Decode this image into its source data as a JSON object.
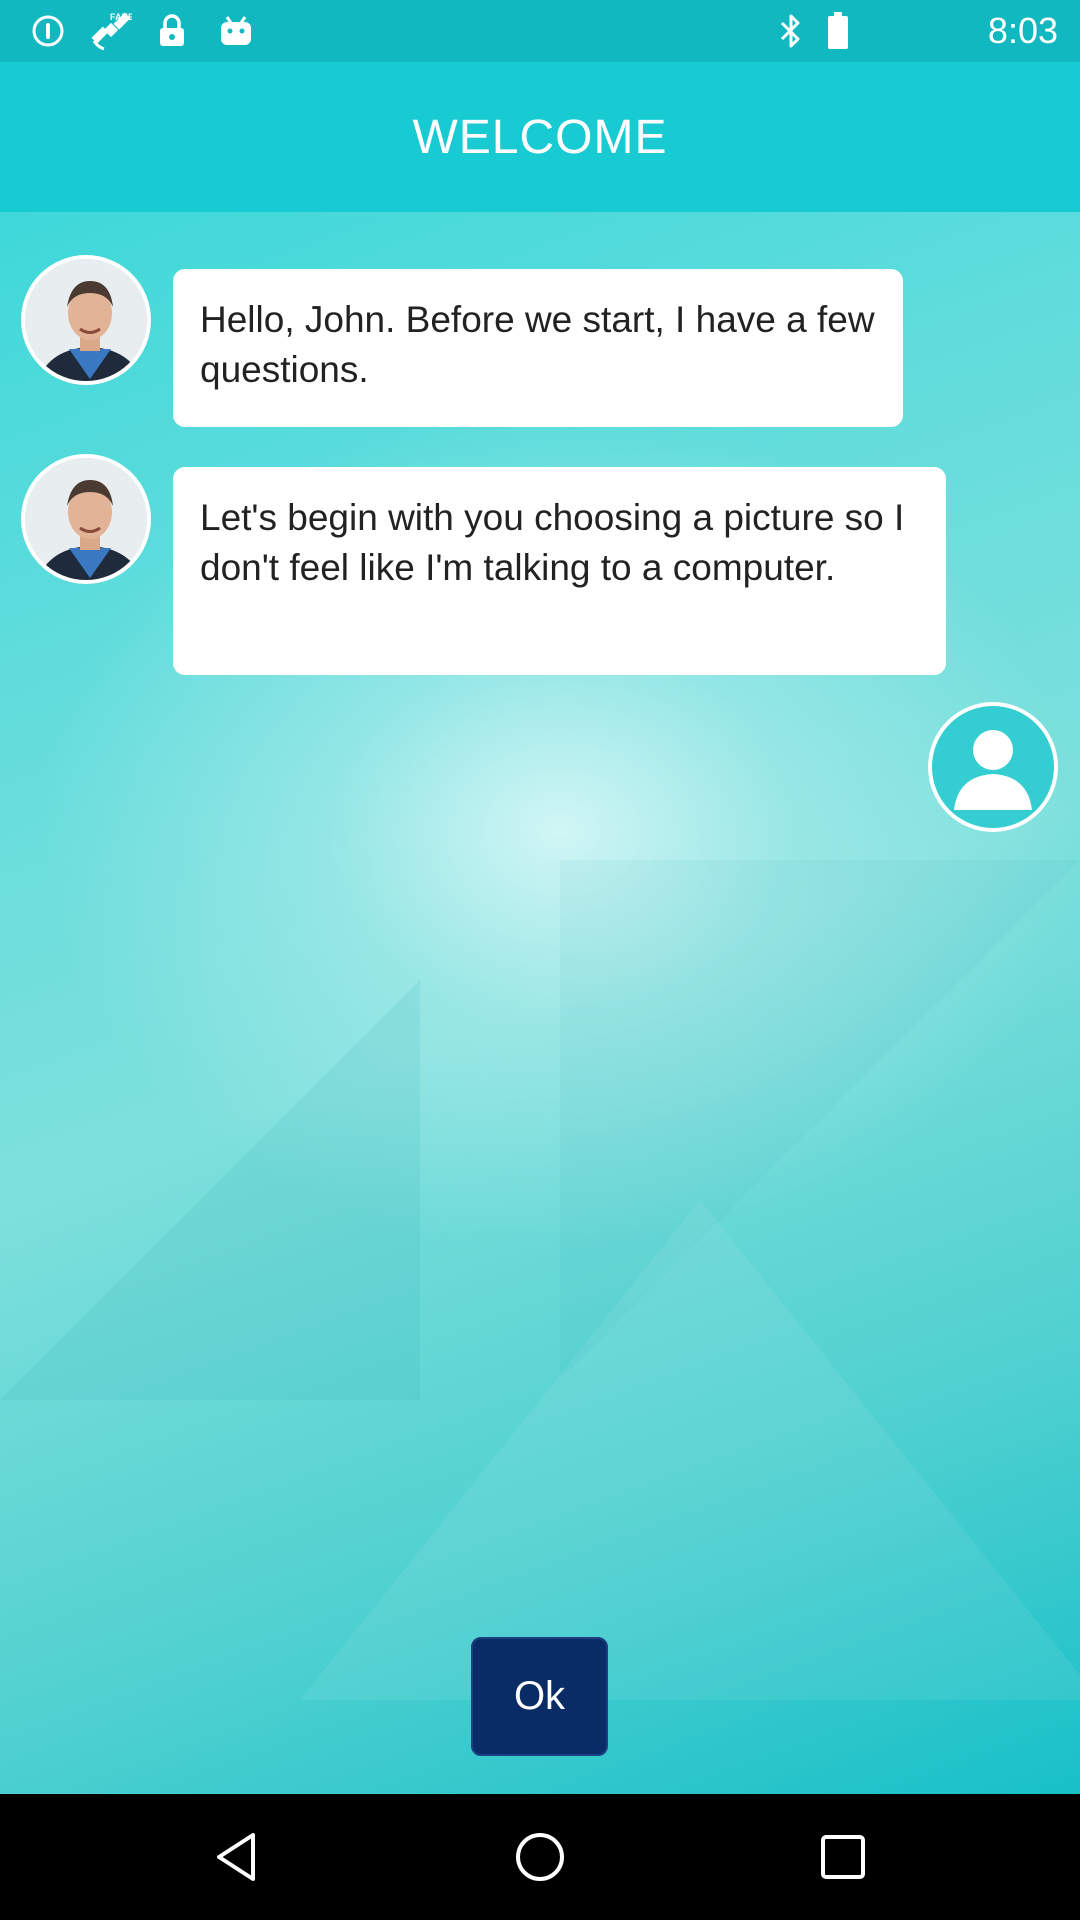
{
  "status_bar": {
    "time": "8:03",
    "left_icons": [
      "info-circle-icon",
      "fake-gps-satellite-icon",
      "lock-icon",
      "android-robot-icon"
    ],
    "right_icons": [
      "bluetooth-icon",
      "battery-icon"
    ]
  },
  "header": {
    "title": "WELCOME"
  },
  "chat": {
    "messages": [
      {
        "sender": "host",
        "text": "Hello, John. Before we start, I have a few questions."
      },
      {
        "sender": "host",
        "text": "Let's begin with you choosing a picture so I don't feel like I'm talking to a computer."
      }
    ],
    "user_avatar": "person-placeholder-icon"
  },
  "actions": {
    "ok_label": "Ok"
  },
  "nav_bar": {
    "icons": [
      "back-triangle-icon",
      "home-circle-icon",
      "recents-square-icon"
    ]
  },
  "colors": {
    "status_bar": "#12b8c0",
    "header": "#18cad2",
    "ok_button": "#0a2c66",
    "bubble": "#ffffff"
  }
}
